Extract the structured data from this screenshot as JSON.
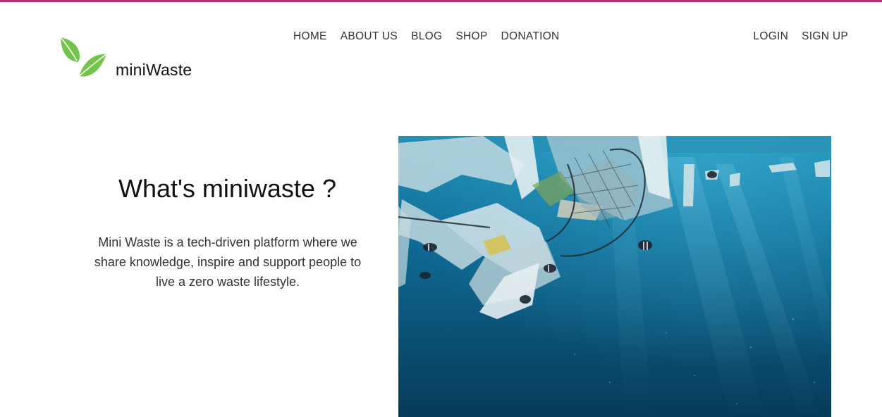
{
  "brand": {
    "name": "miniWaste",
    "accent_color": "#b0306a",
    "leaf_color": "#72c44a"
  },
  "nav": {
    "main": [
      "HOME",
      "ABOUT US",
      "BLOG",
      "SHOP",
      "DONATION"
    ],
    "auth": [
      "LOGIN",
      "SIGN UP"
    ]
  },
  "intro": {
    "title": "What's miniwaste ?",
    "text": "Mini Waste is a tech-driven platform where we share knowledge, inspire and support people to live a zero waste lifestyle."
  },
  "hero": {
    "icon": "ocean-plastic-photo"
  }
}
